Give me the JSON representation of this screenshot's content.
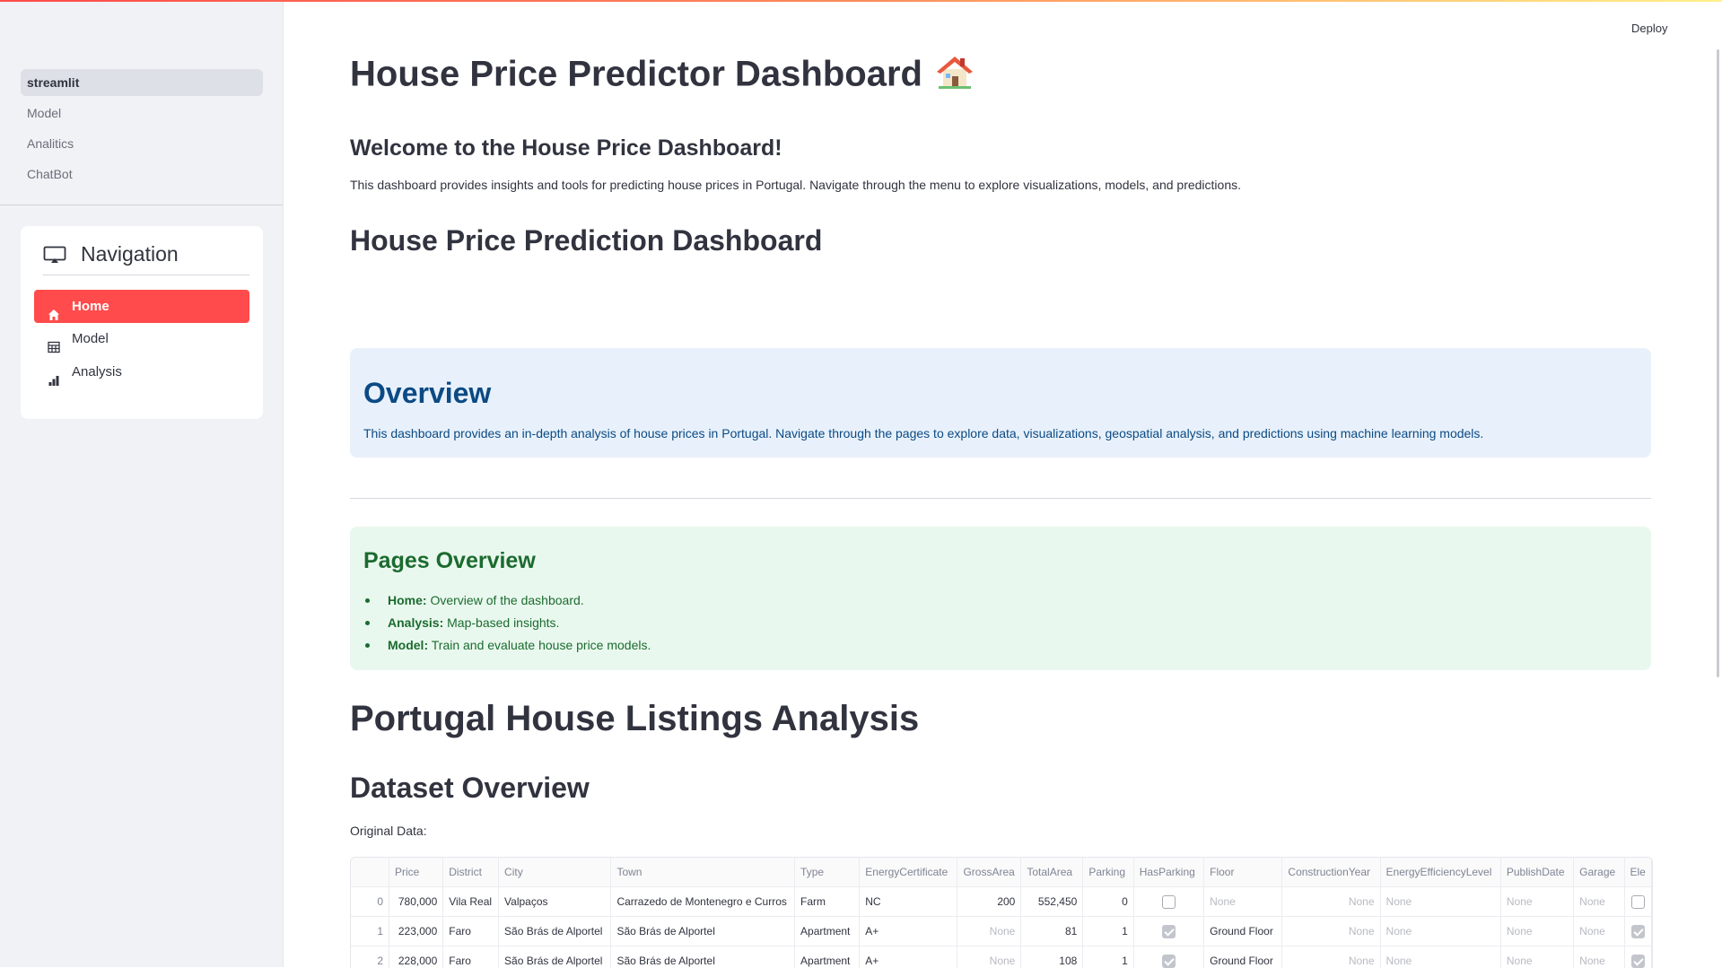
{
  "header": {
    "deploy_label": "Deploy"
  },
  "sidebar": {
    "pages": [
      {
        "label": "streamlit",
        "active": true
      },
      {
        "label": "Model",
        "active": false
      },
      {
        "label": "Analitics",
        "active": false
      },
      {
        "label": "ChatBot",
        "active": false
      }
    ],
    "nav": {
      "title": "Navigation",
      "options": [
        {
          "label": "Home",
          "icon": "house-icon",
          "active": true
        },
        {
          "label": "Model",
          "icon": "table-icon",
          "active": false
        },
        {
          "label": "Analysis",
          "icon": "bar-chart-icon",
          "active": false
        }
      ]
    }
  },
  "main": {
    "title": "House Price Predictor Dashboard",
    "title_icon": "house-emoji-icon",
    "welcome": "Welcome to the House Price Dashboard!",
    "intro": "This dashboard provides insights and tools for predicting house prices in Portugal. Navigate through the menu to explore visualizations, models, and predictions.",
    "section_title": "House Price Prediction Dashboard",
    "overview": {
      "title": "Overview",
      "text": "This dashboard provides an in-depth analysis of house prices in Portugal. Navigate through the pages to explore data, visualizations, geospatial analysis, and predictions using machine learning models."
    },
    "pages_overview": {
      "title": "Pages Overview",
      "items": [
        {
          "name": "Home:",
          "desc": "Overview of the dashboard."
        },
        {
          "name": "Analysis:",
          "desc": "Map-based insights."
        },
        {
          "name": "Model:",
          "desc": "Train and evaluate house price models."
        }
      ]
    },
    "listings_title": "Portugal House Listings Analysis",
    "dataset_title": "Dataset Overview",
    "original_data_label": "Original Data:",
    "table": {
      "columns": [
        "",
        "Price",
        "District",
        "City",
        "Town",
        "Type",
        "EnergyCertificate",
        "GrossArea",
        "TotalArea",
        "Parking",
        "HasParking",
        "Floor",
        "ConstructionYear",
        "EnergyEfficiencyLevel",
        "PublishDate",
        "Garage",
        "Ele"
      ],
      "rows": [
        {
          "idx": "0",
          "Price": "780,000",
          "District": "Vila Real",
          "City": "Valpaços",
          "Town": "Carrazedo de Montenegro e Curros",
          "Type": "Farm",
          "EnergyCertificate": "NC",
          "GrossArea": "200",
          "TotalArea": "552,450",
          "Parking": "0",
          "HasParking": false,
          "Floor": "None",
          "ConstructionYear": "None",
          "EnergyEfficiencyLevel": "None",
          "PublishDate": "None",
          "Garage": "None",
          "Ele": false
        },
        {
          "idx": "1",
          "Price": "223,000",
          "District": "Faro",
          "City": "São Brás de Alportel",
          "Town": "São Brás de Alportel",
          "Type": "Apartment",
          "EnergyCertificate": "A+",
          "GrossArea": "None",
          "TotalArea": "81",
          "Parking": "1",
          "HasParking": true,
          "Floor": "Ground Floor",
          "ConstructionYear": "None",
          "EnergyEfficiencyLevel": "None",
          "PublishDate": "None",
          "Garage": "None",
          "Ele": true
        },
        {
          "idx": "2",
          "Price": "228,000",
          "District": "Faro",
          "City": "São Brás de Alportel",
          "Town": "São Brás de Alportel",
          "Type": "Apartment",
          "EnergyCertificate": "A+",
          "GrossArea": "None",
          "TotalArea": "108",
          "Parking": "1",
          "HasParking": true,
          "Floor": "Ground Floor",
          "ConstructionYear": "None",
          "EnergyEfficiencyLevel": "None",
          "PublishDate": "None",
          "Garage": "None",
          "Ele": true
        }
      ]
    }
  }
}
